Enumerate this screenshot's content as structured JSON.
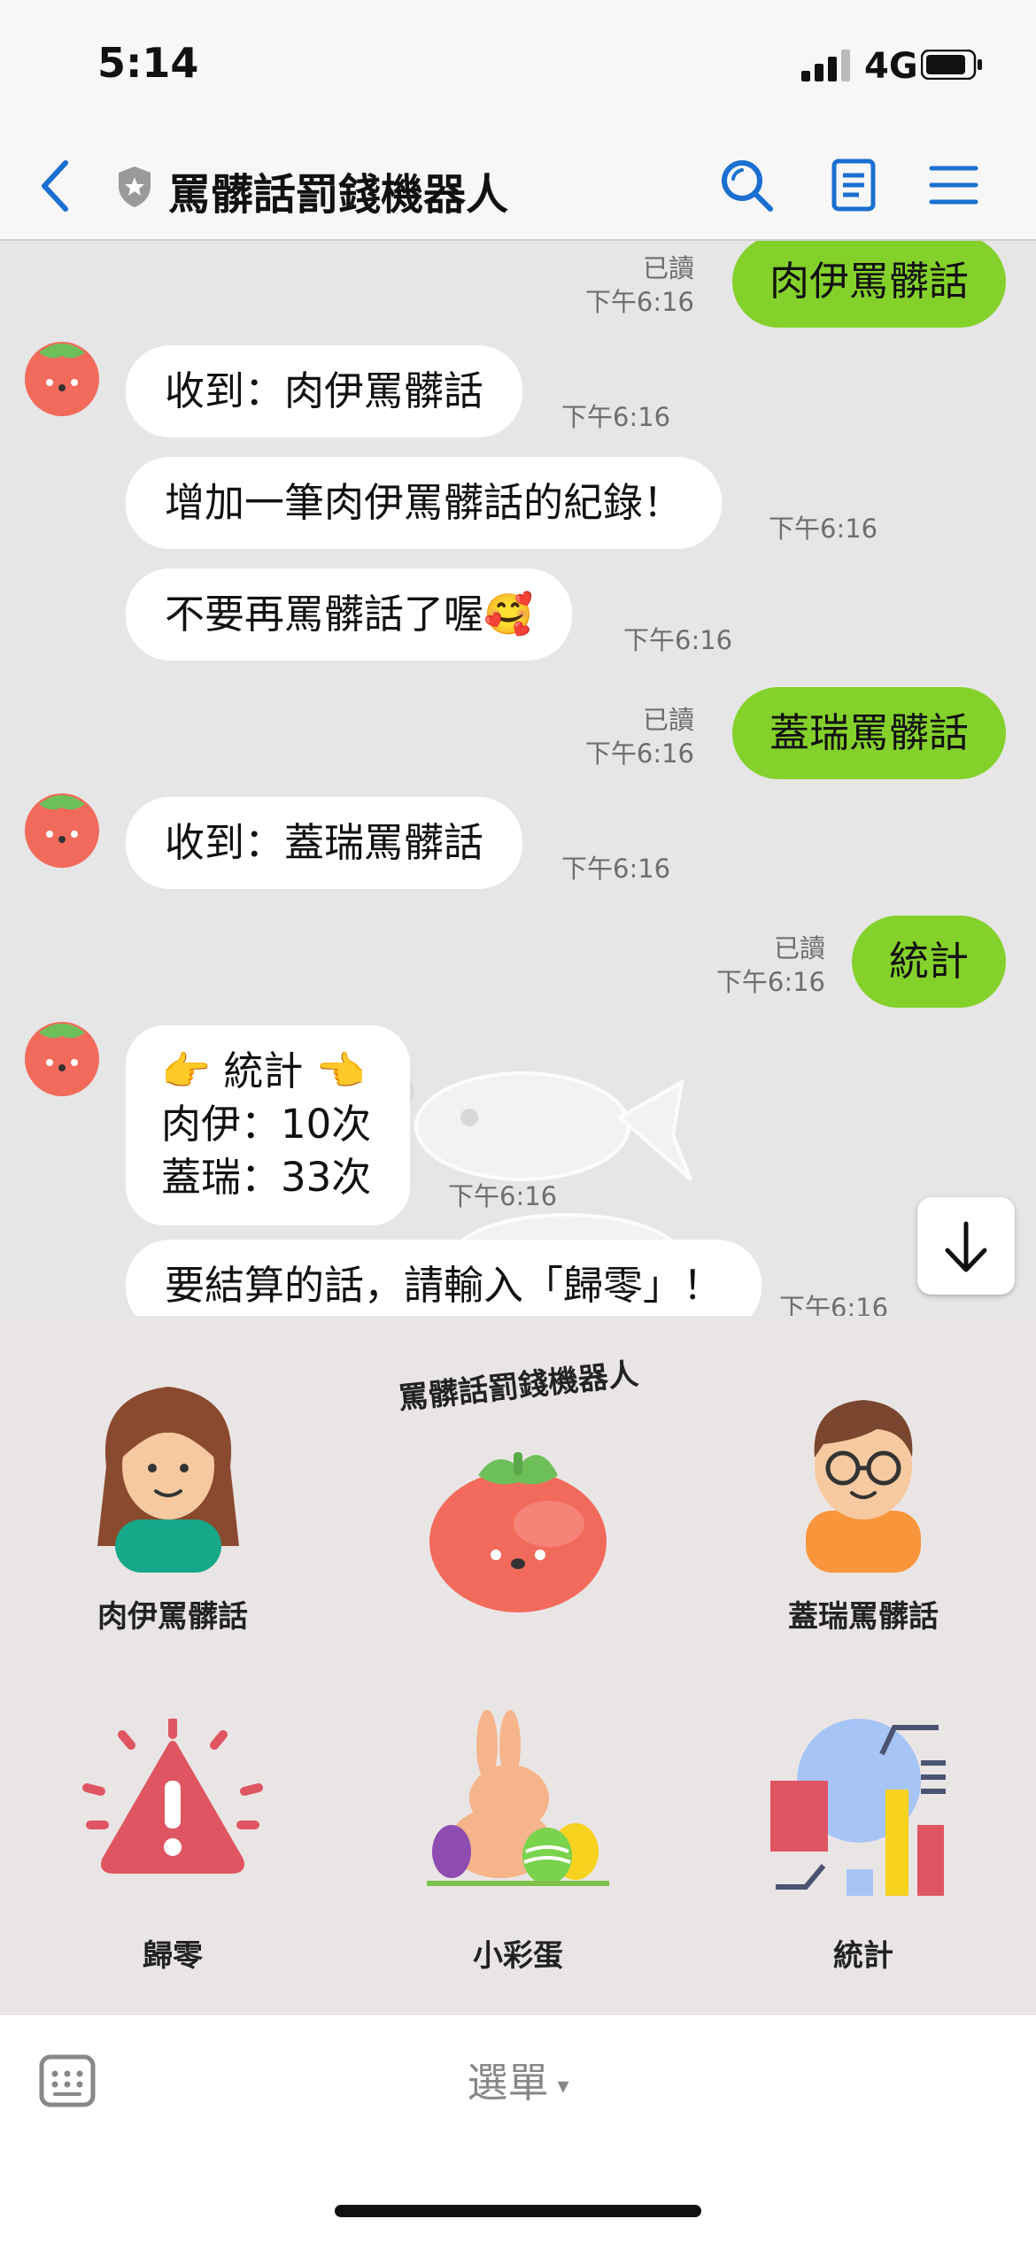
{
  "status_bar": {
    "time": "5:14",
    "network": "4G"
  },
  "nav": {
    "title": "罵髒話罰錢機器人"
  },
  "messages": {
    "m1": {
      "text": "肉伊罵髒話",
      "read": "已讀",
      "time": "下午6:16"
    },
    "m2": {
      "text": "收到：肉伊罵髒話",
      "time": "下午6:16"
    },
    "m3": {
      "text": "增加一筆肉伊罵髒話的紀錄！",
      "time": "下午6:16"
    },
    "m4": {
      "text": "不要再罵髒話了喔",
      "emoji": "🥰",
      "time": "下午6:16"
    },
    "m5": {
      "text": "蓋瑞罵髒話",
      "read": "已讀",
      "time": "下午6:16"
    },
    "m6": {
      "text": "收到：蓋瑞罵髒話",
      "time": "下午6:16"
    },
    "m7": {
      "text": "統計",
      "read": "已讀",
      "time": "下午6:16"
    },
    "m8": {
      "line1": "👉 統計 👈",
      "line2": "肉伊：10次",
      "line3": "蓋瑞：33次",
      "time": "下午6:16"
    },
    "m9": {
      "text": "要結算的話，請輸入「歸零」！",
      "time": "下午6:16"
    }
  },
  "rich_menu": {
    "logo_text": "罵髒話罰錢機器人",
    "items": [
      {
        "label": "肉伊罵髒話"
      },
      {
        "label": "蓋瑞罵髒話"
      },
      {
        "label": "歸零"
      },
      {
        "label": "小彩蛋"
      },
      {
        "label": "統計"
      }
    ]
  },
  "bottom": {
    "menu_toggle": "選單",
    "caret": "▾"
  },
  "colors": {
    "accent": "#1a6fd1",
    "outgoing_bubble": "#84d12b",
    "chat_bg": "#e6e6e6",
    "menu_bg": "#eae5e5"
  }
}
